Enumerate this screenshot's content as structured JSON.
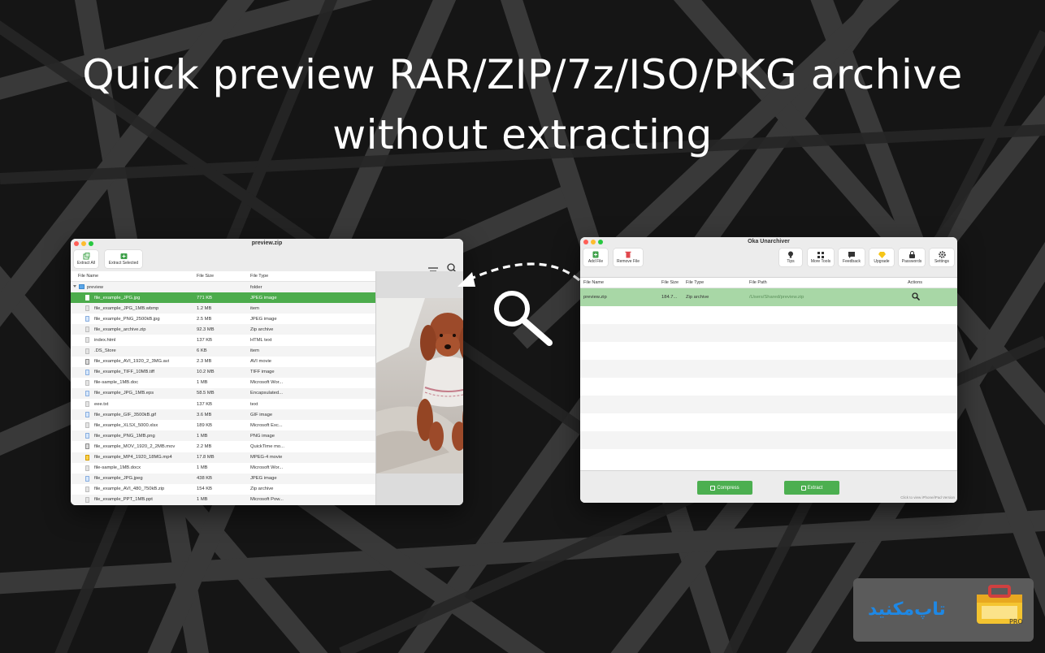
{
  "headline": {
    "line1": "Quick preview RAR/ZIP/7z/ISO/PKG archive",
    "line2": "without extracting"
  },
  "preview_window": {
    "title": "preview.zip",
    "toolbar": {
      "extract_all": "Extract All",
      "extract_selected": "Extract Selected"
    },
    "columns": {
      "name": "File Name",
      "size": "File Size",
      "type": "File Type"
    },
    "rows": [
      {
        "name": "preview",
        "size": "",
        "type": "folder",
        "icon": "folder",
        "state": ""
      },
      {
        "name": "file_example_JPG.jpg",
        "size": "771 KB",
        "type": "JPEG image",
        "icon": "img",
        "state": "selected"
      },
      {
        "name": "file_example_JPG_1MB.wbmp",
        "size": "1.2 MB",
        "type": "item",
        "icon": "doc",
        "state": ""
      },
      {
        "name": "file_example_PNG_2500kB.jpg",
        "size": "2.5 MB",
        "type": "JPEG image",
        "icon": "img",
        "state": ""
      },
      {
        "name": "file_example_archive.zip",
        "size": "92.3 MB",
        "type": "Zip archive",
        "icon": "doc",
        "state": ""
      },
      {
        "name": "index.html",
        "size": "137 KB",
        "type": "HTML text",
        "icon": "doc",
        "state": ""
      },
      {
        "name": ".DS_Store",
        "size": "6 KB",
        "type": "item",
        "icon": "doc",
        "state": ""
      },
      {
        "name": "file_example_AVI_1920_2_3MG.avi",
        "size": "2.3 MB",
        "type": "AVI movie",
        "icon": "vid",
        "state": ""
      },
      {
        "name": "file_example_TIFF_10MB.tiff",
        "size": "10.2 MB",
        "type": "TIFF image",
        "icon": "img",
        "state": ""
      },
      {
        "name": "file-sample_1MB.doc",
        "size": "1 MB",
        "type": "Microsoft Wor...",
        "icon": "doc",
        "state": ""
      },
      {
        "name": "file_example_JPG_1MB.eps",
        "size": "58.5 MB",
        "type": "Encapsulated...",
        "icon": "img",
        "state": ""
      },
      {
        "name": "eee.txt",
        "size": "137 KB",
        "type": "text",
        "icon": "doc",
        "state": ""
      },
      {
        "name": "file_example_GIF_3500kB.gif",
        "size": "3.6 MB",
        "type": "GIF image",
        "icon": "img",
        "state": ""
      },
      {
        "name": "file_example_XLSX_5000.xlsx",
        "size": "189 KB",
        "type": "Microsoft Exc...",
        "icon": "doc",
        "state": ""
      },
      {
        "name": "file_example_PNG_1MB.png",
        "size": "1 MB",
        "type": "PNG image",
        "icon": "img",
        "state": ""
      },
      {
        "name": "file_example_MOV_1920_2_2MB.mov",
        "size": "2.2 MB",
        "type": "QuickTime mo...",
        "icon": "vid",
        "state": ""
      },
      {
        "name": "file_example_MP4_1920_18MG.mp4",
        "size": "17.8 MB",
        "type": "MPEG-4 movie",
        "icon": "zip",
        "state": ""
      },
      {
        "name": "file-sample_1MB.docx",
        "size": "1 MB",
        "type": "Microsoft Wor...",
        "icon": "doc",
        "state": ""
      },
      {
        "name": "file_example_JPG.jpeg",
        "size": "438 KB",
        "type": "JPEG image",
        "icon": "img",
        "state": ""
      },
      {
        "name": "file_example_AVI_480_750kB.zip",
        "size": "154 KB",
        "type": "Zip archive",
        "icon": "doc",
        "state": ""
      },
      {
        "name": "file_example_PPT_1MB.ppt",
        "size": "1 MB",
        "type": "Microsoft Pow...",
        "icon": "doc",
        "state": ""
      }
    ]
  },
  "main_window": {
    "title": "Oka Unarchiver",
    "toolbar": {
      "add_file": "Add File",
      "remove_file": "Remove File",
      "tips": "Tips",
      "more_tools": "More Tools",
      "feedback": "Feedback",
      "upgrade": "Upgrade",
      "passwords": "Passwords",
      "settings": "Settings"
    },
    "columns": {
      "name": "File Name",
      "size": "File Size",
      "type": "File Type",
      "path": "File Path",
      "actions": "Actions"
    },
    "rows": [
      {
        "name": "preview.zip",
        "size": "184.7...",
        "type": "Zip archive",
        "path": "/Users/Shared/preview.zip"
      }
    ],
    "compress_label": "Compress",
    "extract_label": "Extract",
    "hint": "Click to view iPhone/iPad Version"
  },
  "colors": {
    "accent_green": "#4caf50",
    "selected_row": "#4cac4c",
    "selected_row_light": "#a8d7a6"
  },
  "icons": {
    "preview_toolbar": [
      "extract-all-icon",
      "extract-selected-icon",
      "filter-icon",
      "search-icon"
    ],
    "main_toolbar": [
      "add-file-icon",
      "trash-icon",
      "lightbulb-icon",
      "grid-icon",
      "feedback-icon",
      "diamond-icon",
      "lock-icon",
      "gear-icon"
    ],
    "overlay": [
      "magnifier-icon",
      "dashed-arrow-icon"
    ]
  },
  "badge": {
    "text": "تاپ‌مکنید"
  }
}
